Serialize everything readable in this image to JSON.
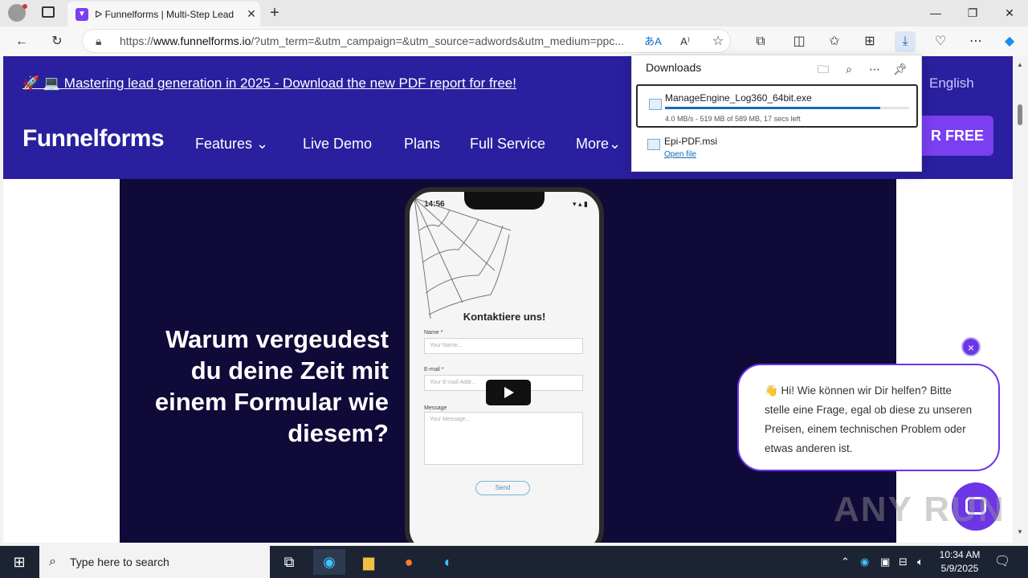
{
  "browser": {
    "tab_title": "ᐅ Funnelforms | Multi-Step Lead",
    "tab_close": "✕",
    "new_tab": "+",
    "url_prefix": "https://",
    "url_domain": "www.funnelforms.io",
    "url_rest": "/?utm_term=&utm_campaign=&utm_source=adwords&utm_medium=ppc...",
    "win_minimize": "—",
    "win_maximize": "❐",
    "win_close": "✕"
  },
  "downloads": {
    "title": "Downloads",
    "items": [
      {
        "name": "ManageEngine_Log360_64bit.exe",
        "meta": "4.0 MB/s - 519 MB of 589 MB, 17 secs left",
        "progress": 0.88
      },
      {
        "name": "Epi-PDF.msi",
        "action": "Open file"
      }
    ]
  },
  "site": {
    "announcement": "🚀 💻 Mastering lead generation in 2025 - Download the new PDF report for free!",
    "language": "English",
    "logo": "Funnelforms",
    "nav": [
      "Features ⌄",
      "Live Demo",
      "Plans",
      "Full Service",
      "More⌄"
    ],
    "cta": "R FREE",
    "hero_headline": "Warum vergeudest du deine Zeit mit einem Formular wie diesem?",
    "phone": {
      "time": "14:56",
      "status": "▾ ▴ ▮",
      "form_title": "Kontaktiere uns!",
      "name_label": "Name *",
      "name_placeholder": "Your Name...",
      "email_label": "E-mail *",
      "email_placeholder": "Your E-mail Addr...",
      "message_label": "Message",
      "message_placeholder": "Your Message...",
      "send": "Send"
    }
  },
  "chat": {
    "message": "👋 Hi! Wie können wir Dir helfen? Bitte stelle eine Frage, egal ob diese zu unseren Preisen, einem technischen Problem oder etwas anderen ist.",
    "close": "×"
  },
  "watermark": "ANY RUN",
  "taskbar": {
    "search_placeholder": "Type here to search",
    "time": "10:34 AM",
    "date": "5/9/2025"
  }
}
